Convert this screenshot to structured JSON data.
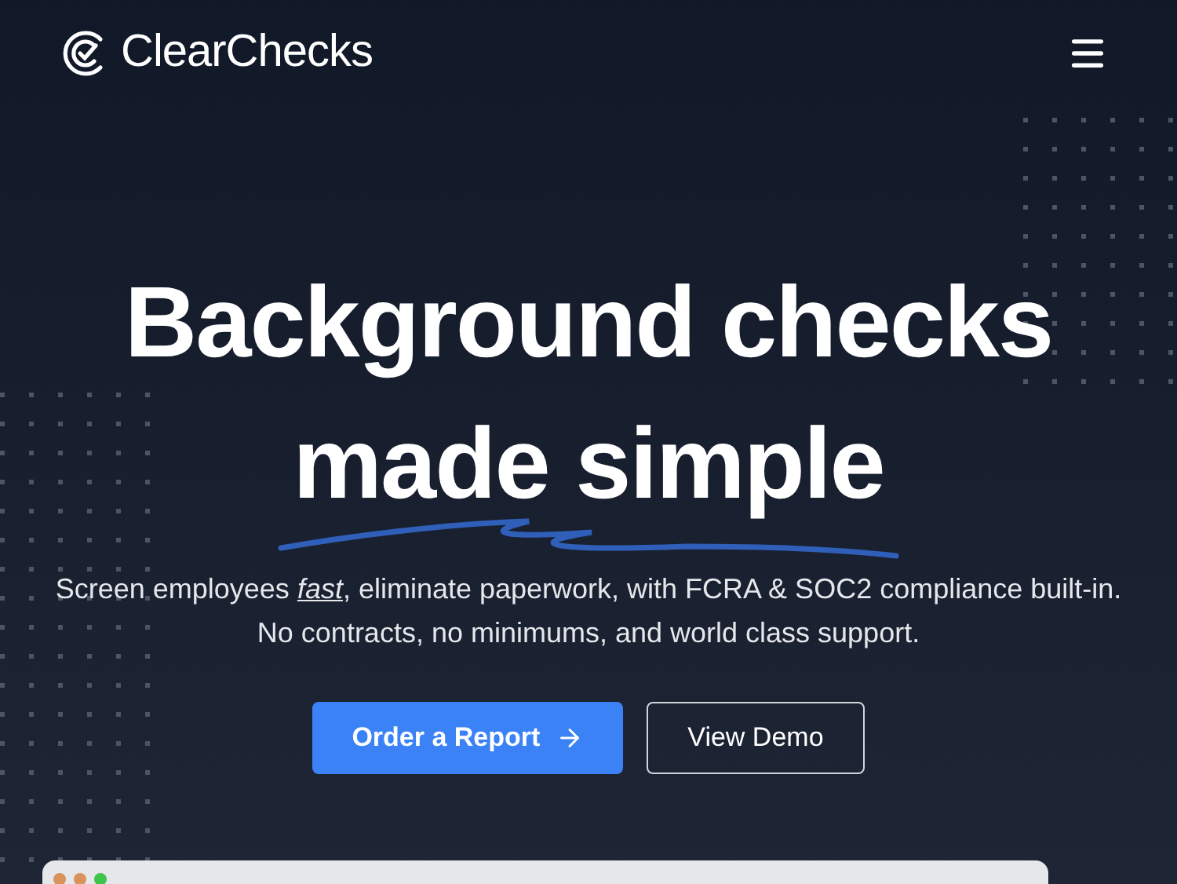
{
  "header": {
    "logo_text": "ClearChecks"
  },
  "hero": {
    "headline_lines": [
      "Background checks",
      "made simple"
    ],
    "subtitle_lines": [
      "Screen employees *fast*, eliminate paperwork, with FCRA & SOC2 compliance built-in.",
      "No contracts, no minimums, and world class support."
    ],
    "buttons": [
      {
        "label": "Order a Report",
        "kind": "primary"
      },
      {
        "label": "View Demo",
        "kind": "outline"
      }
    ]
  },
  "preview_window": {
    "dots": [
      {
        "color": "#d9925a"
      },
      {
        "color": "#d9925a"
      },
      {
        "color": "#3ec44a"
      }
    ]
  }
}
